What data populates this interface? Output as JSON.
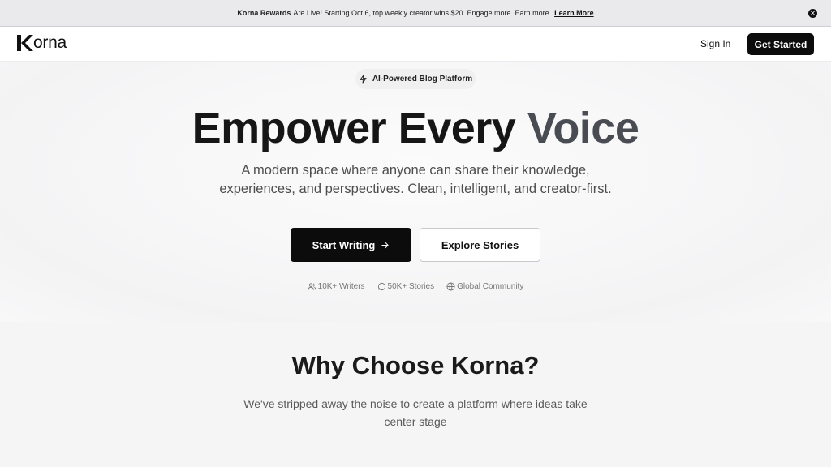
{
  "banner": {
    "brand": "Korna Rewards",
    "message": "Are Live! Starting Oct 6, top weekly creator wins $20. Engage more. Earn more.",
    "link": "Learn More",
    "close_icon": "close-icon"
  },
  "nav": {
    "logo_text": "orna",
    "sign_in": "Sign In",
    "get_started": "Get Started"
  },
  "hero": {
    "badge": "AI-Powered Blog Platform",
    "badge_icon": "lightning-icon",
    "title_main": "Empower Every ",
    "title_accent": "Voice",
    "subtitle": "A modern space where anyone can share their knowledge, experiences, and perspectives. Clean, intelligent, and creator-first.",
    "primary_button": "Start Writing",
    "primary_icon": "arrow-right-icon",
    "secondary_button": "Explore Stories",
    "stats": [
      {
        "icon": "users-icon",
        "label": "10K+ Writers"
      },
      {
        "icon": "chat-bubble-icon",
        "label": "50K+ Stories"
      },
      {
        "icon": "globe-icon",
        "label": "Global Community"
      }
    ]
  },
  "why": {
    "title": "Why Choose Korna?",
    "subtitle": "We've stripped away the noise to create a platform where ideas take center stage"
  },
  "colors": {
    "accent": "#4a4c53",
    "primary_button": "#0c0c0c",
    "banner_bg": "#eaeaec",
    "section_bg": "#f5f5f5"
  }
}
